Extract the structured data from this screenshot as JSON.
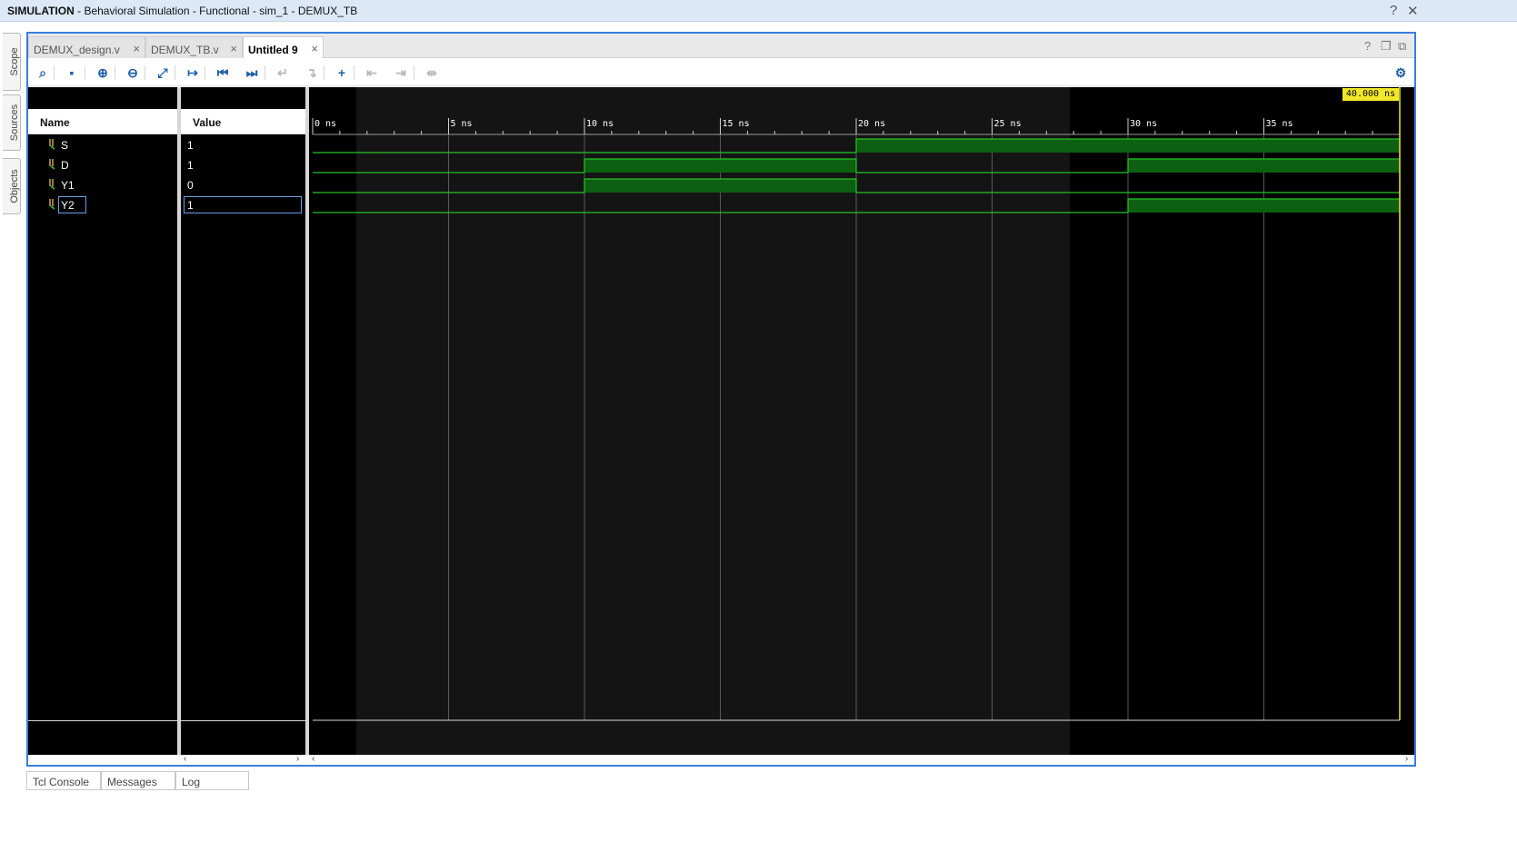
{
  "window": {
    "title_bold": "SIMULATION",
    "title_rest": " - Behavioral Simulation - Functional - sim_1 - DEMUX_TB",
    "help_glyph": "?",
    "close_glyph": "✕"
  },
  "side_tabs": [
    {
      "label": "Scope"
    },
    {
      "label": "Sources"
    },
    {
      "label": "Objects"
    }
  ],
  "editor_tabs": [
    {
      "label": "DEMUX_design.v",
      "active": false
    },
    {
      "label": "DEMUX_TB.v",
      "active": false
    },
    {
      "label": "Untitled 9",
      "active": true
    }
  ],
  "toolbar_icons": [
    {
      "name": "search-icon",
      "glyph": "⌕",
      "enabled": true
    },
    {
      "name": "save-icon",
      "glyph": "▪",
      "enabled": true
    },
    {
      "name": "zoom-in-icon",
      "glyph": "⊕",
      "enabled": true
    },
    {
      "name": "zoom-out-icon",
      "glyph": "⊖",
      "enabled": true
    },
    {
      "name": "zoom-fit-icon",
      "glyph": "⤢",
      "enabled": true
    },
    {
      "name": "go-to-cursor-icon",
      "glyph": "↦",
      "enabled": true
    },
    {
      "name": "go-to-time-zero-icon",
      "glyph": "⏮",
      "enabled": true
    },
    {
      "name": "go-to-last-time-icon",
      "glyph": "⏭",
      "enabled": true
    },
    {
      "name": "previous-transition-icon",
      "glyph": "↵",
      "enabled": false
    },
    {
      "name": "next-transition-icon",
      "glyph": "↴",
      "enabled": false
    },
    {
      "name": "add-marker-icon",
      "glyph": "+",
      "enabled": true
    },
    {
      "name": "previous-marker-icon",
      "glyph": "⇤",
      "enabled": false
    },
    {
      "name": "next-marker-icon",
      "glyph": "⇥",
      "enabled": false
    },
    {
      "name": "swap-cursors-icon",
      "glyph": "⇹",
      "enabled": false
    }
  ],
  "columns": {
    "name": "Name",
    "value": "Value"
  },
  "signals": [
    {
      "name": "S",
      "value": "1",
      "selected": false
    },
    {
      "name": "D",
      "value": "1",
      "selected": false
    },
    {
      "name": "Y1",
      "value": "0",
      "selected": false
    },
    {
      "name": "Y2",
      "value": "1",
      "selected": true
    }
  ],
  "timeline": {
    "unit": "ns",
    "ticks": [
      "0 ns",
      "5 ns",
      "10 ns",
      "15 ns",
      "20 ns",
      "25 ns",
      "30 ns",
      "35 ns"
    ],
    "end_time": 40,
    "cursor_label": "40.000 ns"
  },
  "chart_data": {
    "type": "line",
    "x_label": "",
    "xlim": [
      0,
      40
    ],
    "series": [
      {
        "name": "S",
        "segments": [
          {
            "from": 0,
            "to": 20,
            "value": 0
          },
          {
            "from": 20,
            "to": 40,
            "value": 1
          }
        ]
      },
      {
        "name": "D",
        "segments": [
          {
            "from": 0,
            "to": 10,
            "value": 0
          },
          {
            "from": 10,
            "to": 20,
            "value": 1
          },
          {
            "from": 20,
            "to": 30,
            "value": 0
          },
          {
            "from": 30,
            "to": 40,
            "value": 1
          }
        ]
      },
      {
        "name": "Y1",
        "segments": [
          {
            "from": 0,
            "to": 10,
            "value": 0
          },
          {
            "from": 10,
            "to": 20,
            "value": 1
          },
          {
            "from": 20,
            "to": 40,
            "value": 0
          }
        ]
      },
      {
        "name": "Y2",
        "segments": [
          {
            "from": 0,
            "to": 30,
            "value": 0
          },
          {
            "from": 30,
            "to": 40,
            "value": 1
          }
        ]
      }
    ]
  },
  "bottom_tabs": [
    {
      "label": "Tcl Console"
    },
    {
      "label": "Messages"
    },
    {
      "label": "Log"
    }
  ]
}
